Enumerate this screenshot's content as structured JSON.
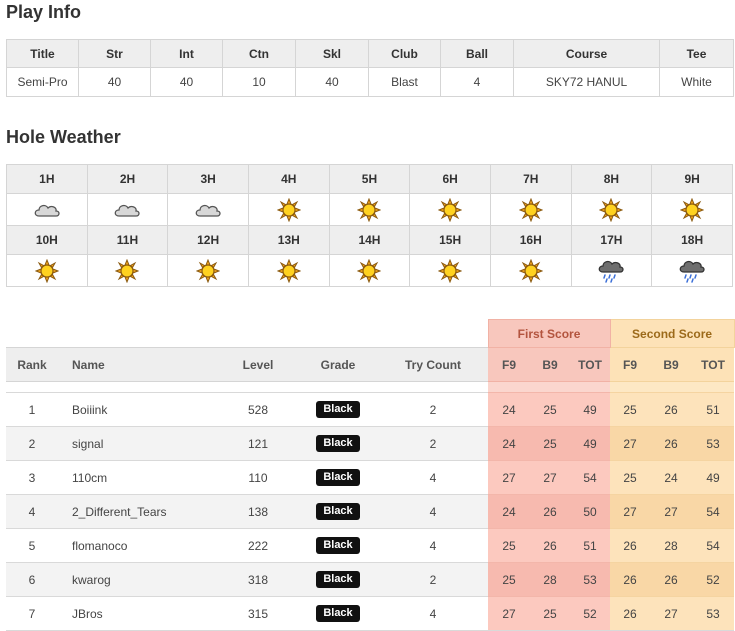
{
  "play_info": {
    "title": "Play Info",
    "headers": [
      "Title",
      "Str",
      "Int",
      "Ctn",
      "Skl",
      "Club",
      "Ball",
      "Course",
      "Tee"
    ],
    "values": [
      "Semi-Pro",
      "40",
      "40",
      "10",
      "40",
      "Blast",
      "4",
      "SKY72 HANUL",
      "White"
    ]
  },
  "hole_weather": {
    "title": "Hole Weather",
    "row1": {
      "holes": [
        "1H",
        "2H",
        "3H",
        "4H",
        "5H",
        "6H",
        "7H",
        "8H",
        "9H"
      ],
      "icons": [
        "cloud-icon",
        "cloud-icon",
        "cloud-icon",
        "sun-icon",
        "sun-icon",
        "sun-icon",
        "sun-icon",
        "sun-icon",
        "sun-icon"
      ]
    },
    "row2": {
      "holes": [
        "10H",
        "11H",
        "12H",
        "13H",
        "14H",
        "15H",
        "16H",
        "17H",
        "18H"
      ],
      "icons": [
        "sun-icon",
        "sun-icon",
        "sun-icon",
        "sun-icon",
        "sun-icon",
        "sun-icon",
        "sun-icon",
        "rain-cloud-icon",
        "rain-cloud-icon"
      ]
    }
  },
  "ranking": {
    "group_headers": {
      "first": "First Score",
      "second": "Second Score"
    },
    "columns": [
      "Rank",
      "Name",
      "Level",
      "Grade",
      "Try Count",
      "F9",
      "B9",
      "TOT",
      "F9",
      "B9",
      "TOT"
    ],
    "colors": {
      "first_score_bg": "#f8c7bd",
      "second_score_bg": "#fde2b7",
      "rank_text": "#3a8a23",
      "grade_badge": "#111111"
    },
    "rows": [
      {
        "rank": "1",
        "name": "Boiiink",
        "level": "528",
        "grade": "Black",
        "try_count": "2",
        "first": [
          "24",
          "25",
          "49"
        ],
        "second": [
          "25",
          "26",
          "51"
        ]
      },
      {
        "rank": "2",
        "name": "signal",
        "level": "121",
        "grade": "Black",
        "try_count": "2",
        "first": [
          "24",
          "25",
          "49"
        ],
        "second": [
          "27",
          "26",
          "53"
        ]
      },
      {
        "rank": "3",
        "name": "110cm",
        "level": "110",
        "grade": "Black",
        "try_count": "4",
        "first": [
          "27",
          "27",
          "54"
        ],
        "second": [
          "25",
          "24",
          "49"
        ]
      },
      {
        "rank": "4",
        "name": "2_Different_Tears",
        "level": "138",
        "grade": "Black",
        "try_count": "4",
        "first": [
          "24",
          "26",
          "50"
        ],
        "second": [
          "27",
          "27",
          "54"
        ]
      },
      {
        "rank": "5",
        "name": "flomanoco",
        "level": "222",
        "grade": "Black",
        "try_count": "4",
        "first": [
          "25",
          "26",
          "51"
        ],
        "second": [
          "26",
          "28",
          "54"
        ]
      },
      {
        "rank": "6",
        "name": "kwarog",
        "level": "318",
        "grade": "Black",
        "try_count": "2",
        "first": [
          "25",
          "28",
          "53"
        ],
        "second": [
          "26",
          "26",
          "52"
        ]
      },
      {
        "rank": "7",
        "name": "JBros",
        "level": "315",
        "grade": "Black",
        "try_count": "4",
        "first": [
          "27",
          "25",
          "52"
        ],
        "second": [
          "26",
          "27",
          "53"
        ]
      }
    ]
  }
}
